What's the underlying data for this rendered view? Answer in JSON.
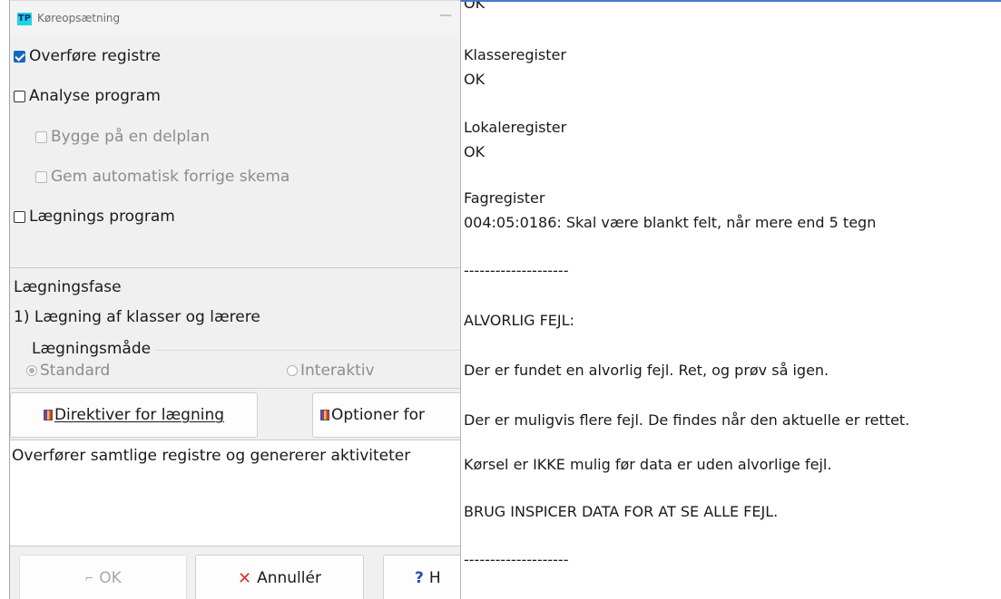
{
  "dialog": {
    "title": "Køreopsætning",
    "app_icon_text": "TP",
    "minimize_glyph": "—",
    "options": {
      "transfer_registers": {
        "label": "Overføre registre",
        "checked": true
      },
      "analysis_program": {
        "label": "Analyse program",
        "checked": false
      },
      "build_on_subplan": {
        "label": "Bygge på en delplan",
        "checked": false,
        "enabled": false
      },
      "autosave_prev_schedule": {
        "label": "Gem automatisk forrige skema",
        "checked": false,
        "enabled": false
      },
      "placement_program": {
        "label": "Lægnings program",
        "checked": false
      }
    },
    "placement_phase_label": "Lægningsfase",
    "placement_phase_value": "1) Lægning af klasser og lærere",
    "placement_mode": {
      "legend": "Lægningsmåde",
      "standard": "Standard",
      "interactive": "Interaktiv",
      "selected": "standard"
    },
    "buttons": {
      "directives": "Direktiver for lægning",
      "options": "Optioner for",
      "ok": "OK",
      "cancel": "Annullér",
      "help": "H"
    },
    "description": "Overfører samtlige registre og genererer aktiviteter"
  },
  "results": {
    "top_partial": "OK",
    "class_register": "Klasseregister",
    "class_register_status": "OK",
    "room_register": "Lokaleregister",
    "room_register_status": "OK",
    "subject_register": "Fagregister",
    "subject_register_error": "004:05:0186: Skal være blankt felt, når mere end 5 tegn",
    "divider_1": "--------------------",
    "severe_error_heading": "ALVORLIG FEJL:",
    "msg_1": "Der er fundet en alvorlig fejl. Ret, og prøv så igen.",
    "msg_2": "Der er muligvis flere fejl. De findes når den aktuelle er rettet.",
    "msg_3": "Kørsel er IKKE mulig før data er uden alvorlige fejl.",
    "msg_4": "BRUG INSPICER DATA FOR AT SE ALLE FEJL.",
    "divider_2": "--------------------"
  },
  "colors": {
    "accent": "#1565c0",
    "cancel_icon": "#d9342b",
    "help_icon": "#1f4fb5",
    "dialog_bg": "#f0f0f0"
  }
}
